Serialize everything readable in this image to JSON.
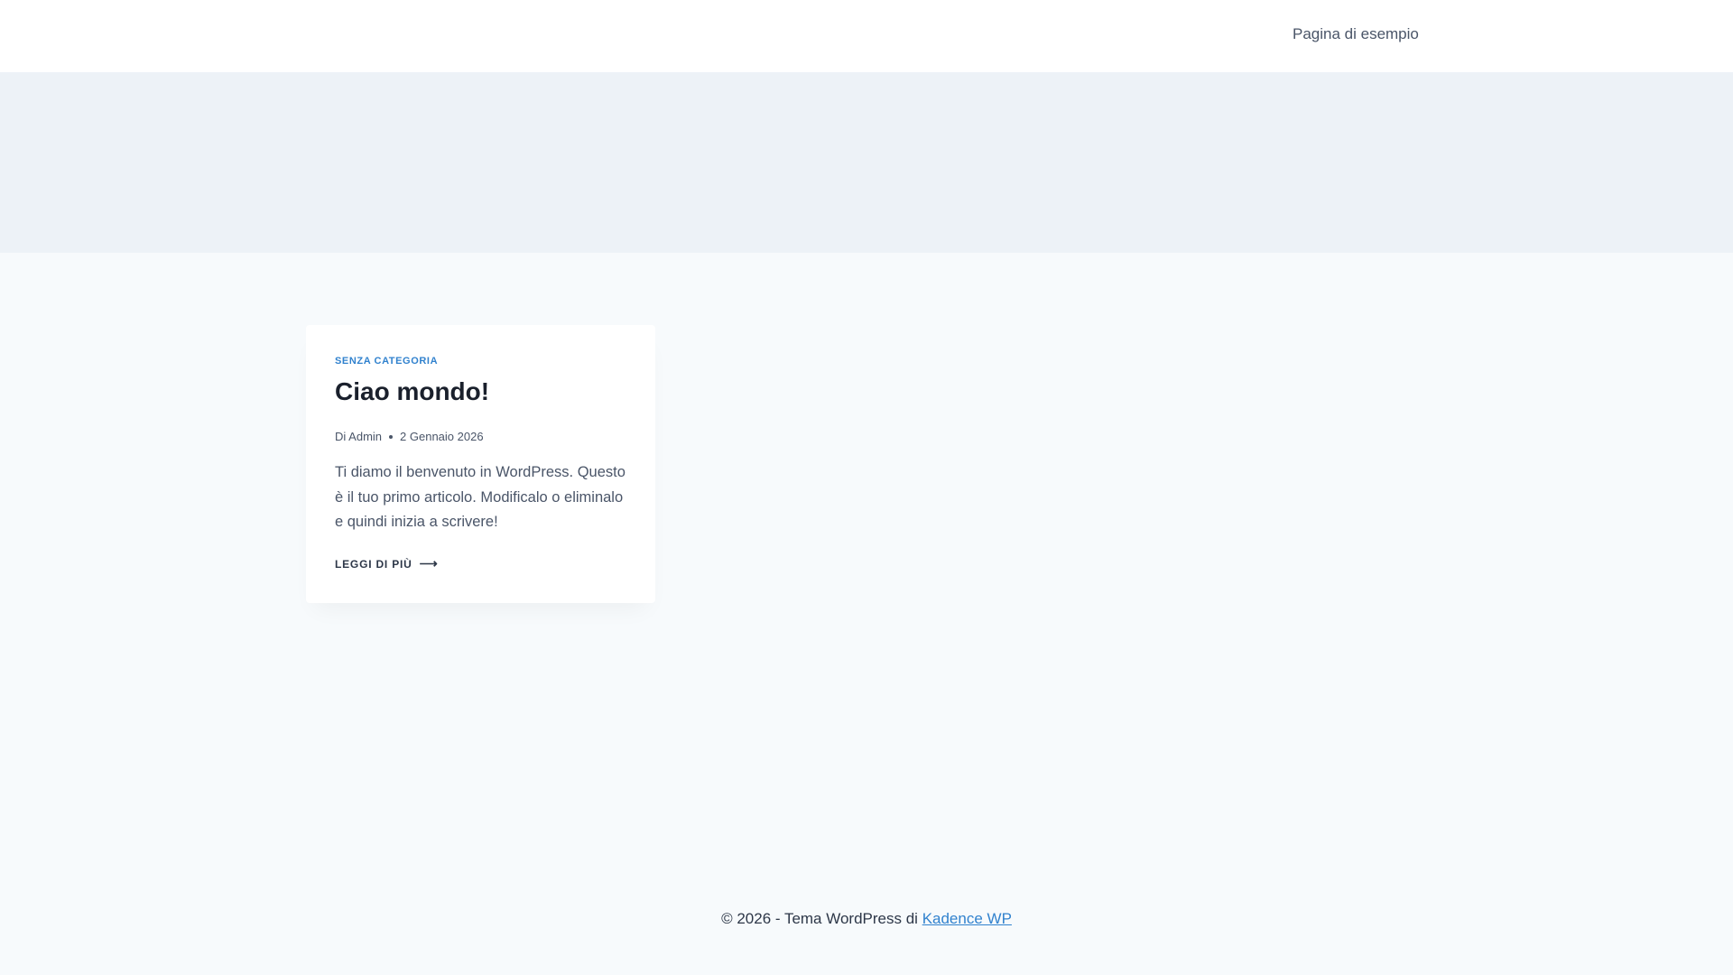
{
  "header": {
    "nav_item": "Pagina di esempio"
  },
  "post": {
    "category": "SENZA CATEGORIA",
    "title": "Ciao mondo!",
    "author": "Di Admin",
    "date": "2 Gennaio 2026",
    "excerpt": "Ti diamo il benvenuto in WordPress. Questo è il tuo primo articolo. Modificalo o eliminalo e quindi inizia a scrivere!",
    "read_more": "LEGGI DI PIÙ",
    "read_more_icon": "arrow-right-icon"
  },
  "footer": {
    "text": "© 2026 - Tema WordPress di ",
    "link": "Kadence WP"
  },
  "colors": {
    "accent": "#3182ce",
    "hero_bg": "#edf2f7",
    "page_bg": "#f7fafc"
  }
}
